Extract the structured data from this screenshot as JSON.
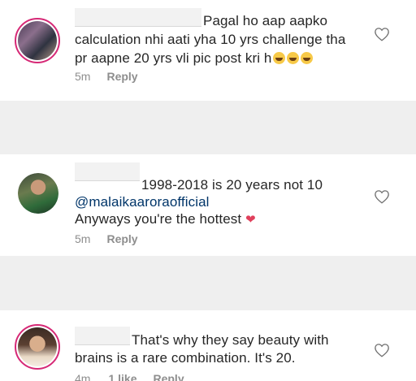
{
  "comments": [
    {
      "lines": [
        "Pagal ho aap aapko",
        "calculation nhi aati yha 10 yrs challenge tha",
        "pr aapne 20 yrs vli pic post kri h"
      ],
      "emoji": "laughing-with-tears-icon ×3",
      "time": "5m",
      "reply_label": "Reply"
    },
    {
      "lines": [
        "1998-2018 is 20 years not 10",
        "@malaikaaroraofficial",
        "Anyways you're the hottest"
      ],
      "emoji": "red-heart-icon",
      "time": "5m",
      "reply_label": "Reply"
    },
    {
      "lines": [
        "That's why they say beauty with",
        "brains is a rare combination. It's 20."
      ],
      "time": "4m",
      "likes_label": "1 like",
      "reply_label": "Reply"
    }
  ],
  "colors": {
    "mention": "#003569",
    "meta": "#8e8e8e",
    "text": "#262626",
    "ring": "#d62976"
  }
}
